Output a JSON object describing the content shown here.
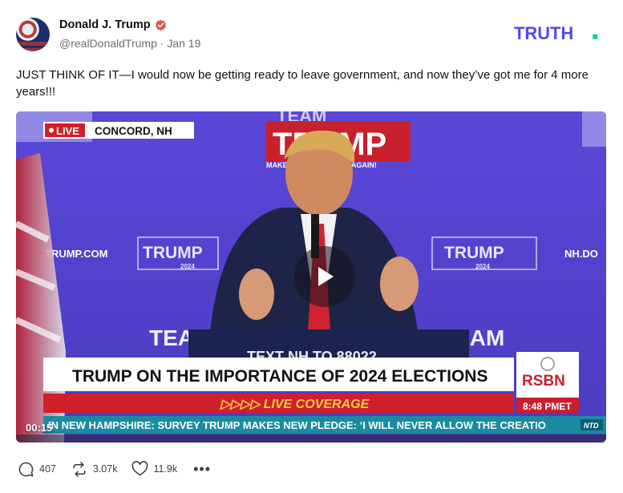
{
  "author": {
    "display_name": "Donald J. Trump",
    "handle": "@realDonaldTrump",
    "separator": "·",
    "date": "Jan 19"
  },
  "brand": {
    "logo_text": "TRUTH",
    "logo_color": "#5448ee",
    "dot_color": "#17d1a0"
  },
  "post": {
    "text": "JUST THINK OF IT—I would now be getting ready to leave government, and now they’ve got me for 4 more years!!!"
  },
  "video": {
    "live_badge": "LIVE",
    "location": "CONCORD, NH",
    "headline": "TRUMP ON THE IMPORTANCE OF 2024 ELECTIONS",
    "live_coverage": "▷▷▷▷ LIVE COVERAGE",
    "ticker": "IN NEW HAMPSHIRE: SURVEY    TRUMP MAKES NEW PLEDGE: ‘I WILL NEVER ALLOW THE CREATIO",
    "network": "RSBN",
    "time": "8:48 PMET",
    "ticker_badge": "NTD",
    "timecode": "00:15",
    "backdrop_team": "TEAM",
    "backdrop_trump": "TRUMP",
    "backdrop_slogan": "MAKE AMERICA GREAT AGAIN!",
    "backdrop_url_left": "TRUMP.COM",
    "backdrop_url_right": "NH.DO",
    "sign_trump": "TRUMP",
    "sign_year": "2024",
    "podium_text": "TEXT NH TO 88022",
    "team_left": "TEA",
    "team_right": "TEAM",
    "play_icon": "play-icon"
  },
  "actions": {
    "replies": "407",
    "retruths": "3.07k",
    "likes": "11.9k",
    "more": "•••"
  },
  "colors": {
    "verified": "#e8534c",
    "video_bg": "#5b49d6",
    "banner_red": "#d0202a",
    "ticker_teal": "#1a8ba0"
  }
}
